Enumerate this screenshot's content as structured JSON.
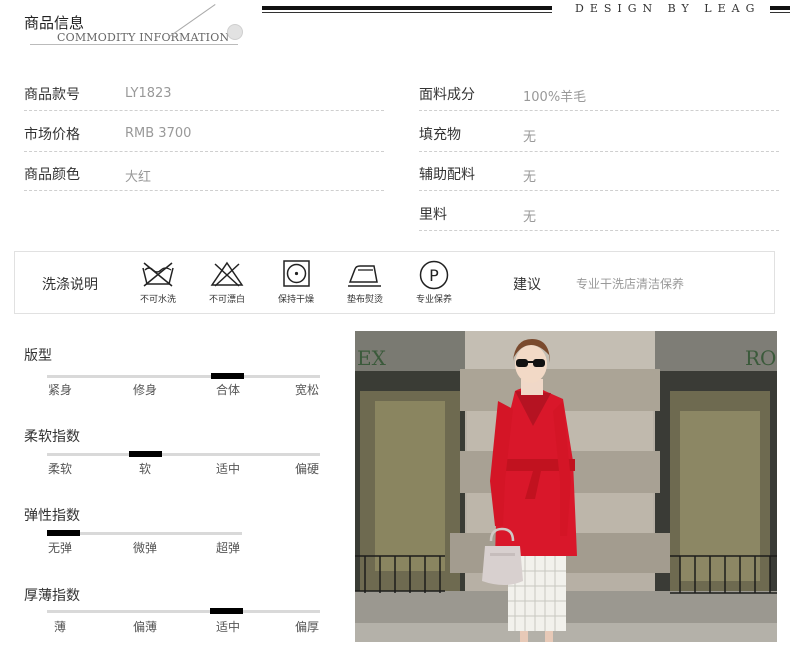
{
  "header": {
    "title": "商品信息",
    "subtitle": "COMMODITY INFORMATION",
    "brand": "DESIGN BY LEAG"
  },
  "info": {
    "left": [
      {
        "label": "商品款号",
        "value": "LY1823"
      },
      {
        "label": "市场价格",
        "value": "RMB 3700"
      },
      {
        "label": "商品颜色",
        "value": "大红"
      }
    ],
    "right": [
      {
        "label": "面料成分",
        "value": "100%羊毛"
      },
      {
        "label": "填充物",
        "value": "无"
      },
      {
        "label": "辅助配料",
        "value": "无"
      },
      {
        "label": "里料",
        "value": "无"
      }
    ]
  },
  "care": {
    "title": "洗涤说明",
    "icons": [
      {
        "icon": "no-water-wash-icon",
        "caption": "不可水洗"
      },
      {
        "icon": "no-bleach-icon",
        "caption": "不可漂白"
      },
      {
        "icon": "keep-dry-icon",
        "caption": "保持干燥"
      },
      {
        "icon": "cloth-iron-icon",
        "caption": "垫布熨烫"
      },
      {
        "icon": "professional-care-icon",
        "caption": "专业保养"
      }
    ],
    "advice_label": "建议",
    "advice_value": "专业干洗店清洁保养"
  },
  "scales": [
    {
      "title": "版型",
      "labels": [
        "紧身",
        "修身",
        "合体",
        "宽松"
      ],
      "selected_index": 2
    },
    {
      "title": "柔软指数",
      "labels": [
        "柔软",
        "软",
        "适中",
        "偏硬"
      ],
      "selected_index": 1
    },
    {
      "title": "弹性指数",
      "labels": [
        "无弹",
        "微弹",
        "超弹"
      ],
      "selected_index": 0
    },
    {
      "title": "厚薄指数",
      "labels": [
        "薄",
        "偏薄",
        "适中",
        "偏厚"
      ],
      "selected_index": 2
    }
  ],
  "photo": {
    "sign_left": "EX",
    "sign_right": "RO"
  },
  "colors": {
    "coat_red": "#d9172a",
    "marker": "#000000",
    "track": "#d9d9d9"
  }
}
